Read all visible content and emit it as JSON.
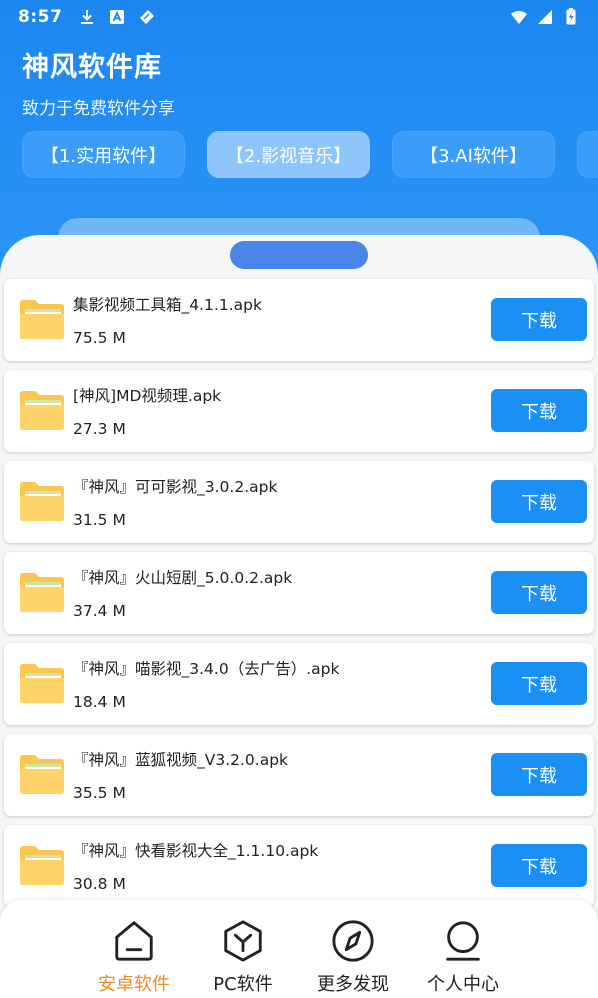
{
  "status_bar": {
    "time": "8:57"
  },
  "header": {
    "title": "神风软件库",
    "subtitle": "致力于免费软件分享"
  },
  "tabs": [
    {
      "label": "【1.实用软件】",
      "active": false
    },
    {
      "label": "【2.影视音乐】",
      "active": true
    },
    {
      "label": "【3.AI软件】",
      "active": false
    },
    {
      "label": "",
      "active": false
    }
  ],
  "files": [
    {
      "name": "集影视频工具箱_4.1.1.apk",
      "size": "75.5 M",
      "button": "下载"
    },
    {
      "name": "[神风]MD视频理.apk",
      "size": "27.3 M",
      "button": "下载"
    },
    {
      "name": "『神风』可可影视_3.0.2.apk",
      "size": "31.5 M",
      "button": "下载"
    },
    {
      "name": "『神风』火山短剧_5.0.0.2.apk",
      "size": "37.4 M",
      "button": "下载"
    },
    {
      "name": "『神风』喵影视_3.4.0（去广告）.apk",
      "size": "18.4 M",
      "button": "下载"
    },
    {
      "name": "『神风』蓝狐视频_V3.2.0.apk",
      "size": "35.5 M",
      "button": "下载"
    },
    {
      "name": "『神风』快看影视大全_1.1.10.apk",
      "size": "30.8 M",
      "button": "下载"
    }
  ],
  "bottom_nav": [
    {
      "label": "安卓软件",
      "icon": "home-icon",
      "active": true
    },
    {
      "label": "PC软件",
      "icon": "cube-icon",
      "active": false
    },
    {
      "label": "更多发现",
      "icon": "compass-icon",
      "active": false
    },
    {
      "label": "个人中心",
      "icon": "user-icon",
      "active": false
    }
  ],
  "colors": {
    "primary": "#1a8ff4",
    "active_nav": "#f08a24",
    "folder": "#fcc64f"
  }
}
